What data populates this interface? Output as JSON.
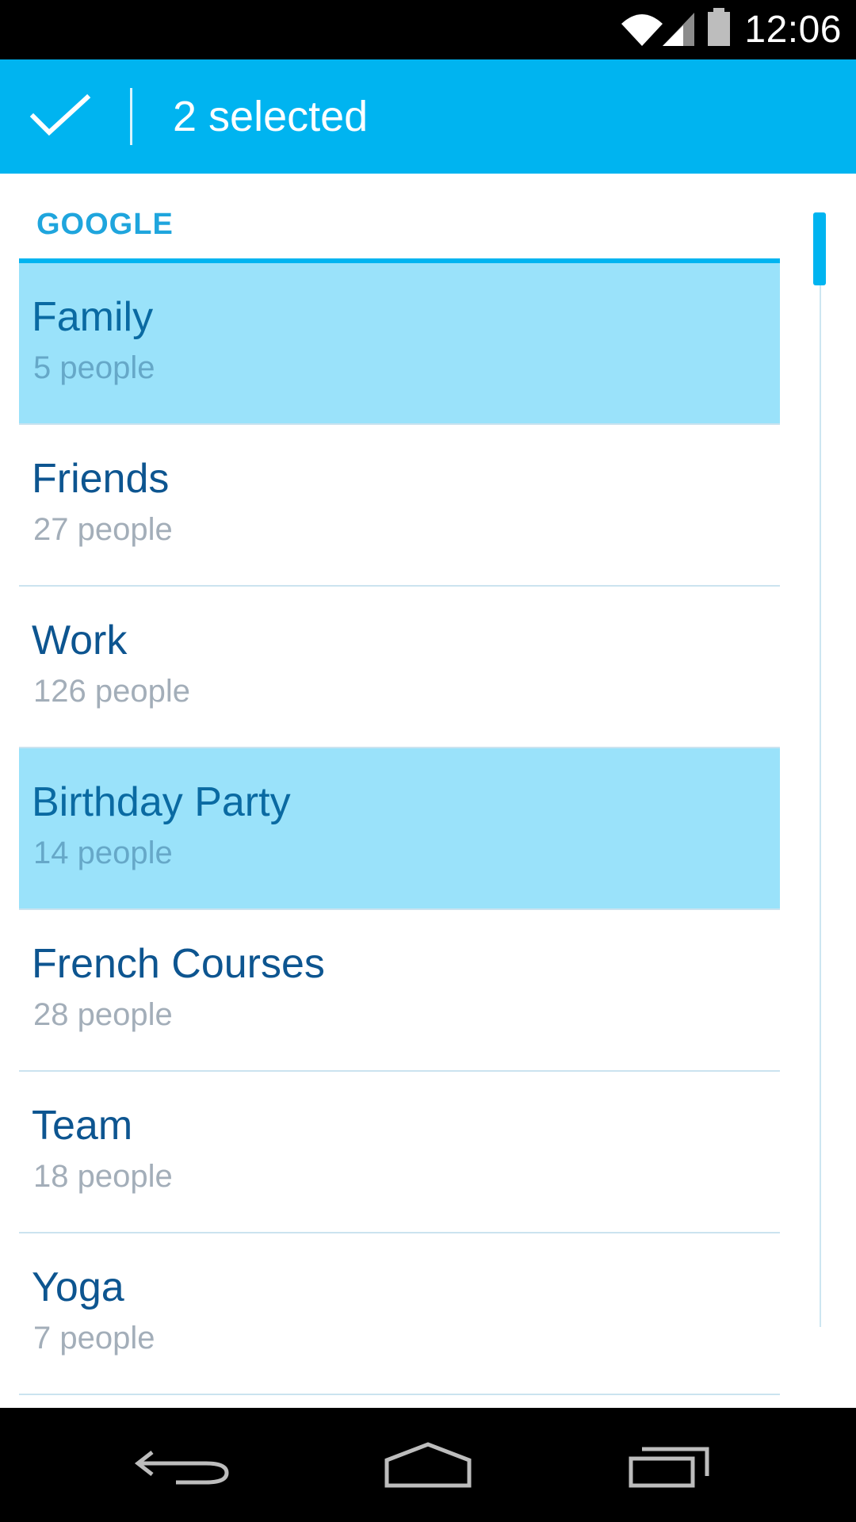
{
  "status_bar": {
    "time": "12:06",
    "icons": [
      "wifi-icon",
      "cell-signal-icon",
      "battery-icon"
    ]
  },
  "action_bar": {
    "done_icon": "checkmark-icon",
    "title": "2 selected"
  },
  "section": {
    "header": "GOOGLE"
  },
  "groups": [
    {
      "name": "Family",
      "count": "5 people",
      "selected": true
    },
    {
      "name": "Friends",
      "count": "27 people",
      "selected": false
    },
    {
      "name": "Work",
      "count": "126 people",
      "selected": false
    },
    {
      "name": "Birthday Party",
      "count": "14 people",
      "selected": true
    },
    {
      "name": "French Courses",
      "count": "28 people",
      "selected": false
    },
    {
      "name": "Team",
      "count": "18 people",
      "selected": false
    },
    {
      "name": "Yoga",
      "count": "7 people",
      "selected": false
    }
  ],
  "nav_bar": {
    "icons": [
      "back-icon",
      "home-icon",
      "recents-icon"
    ]
  },
  "colors": {
    "accent": "#00b4f0",
    "selected_row": "#9ae2fa",
    "primary_text": "#0d5590",
    "secondary_text": "#a3aeb9"
  }
}
